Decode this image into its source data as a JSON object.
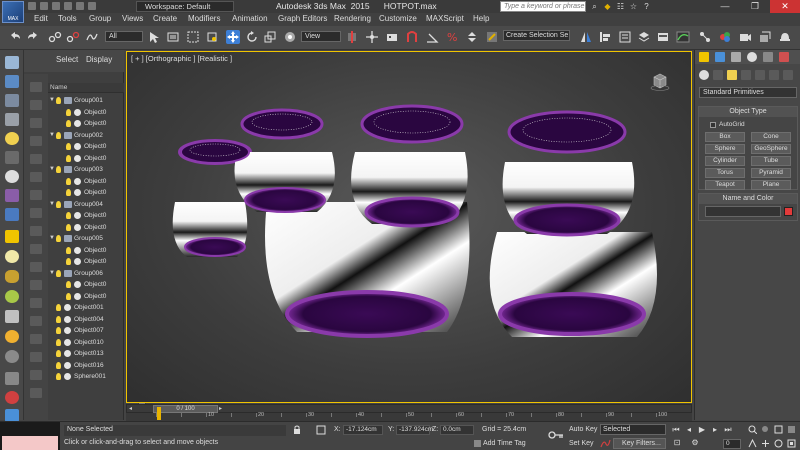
{
  "titlebar": {
    "logo_text": "MAX",
    "workspace_label": "Workspace: Default",
    "app_title": "Autodesk 3ds Max  2015      HOTPOT.max",
    "search_placeholder": "Type a keyword or phrase"
  },
  "menubar": {
    "items": [
      "Edit",
      "Tools",
      "Group",
      "Views",
      "Create",
      "Modifiers",
      "Animation",
      "Graph Editors",
      "Rendering",
      "Customize",
      "MAXScript",
      "Help"
    ]
  },
  "maintoolbar": {
    "selection_filter": "All",
    "reference_coord": "View",
    "named_selection_set": "Create Selection Se"
  },
  "explorer": {
    "tab_select": "Select",
    "tab_display": "Display",
    "column_name": "Name",
    "rows": [
      {
        "label": "Group001",
        "level": 0,
        "type": "group"
      },
      {
        "label": "Object0",
        "level": 1,
        "type": "object"
      },
      {
        "label": "Object0",
        "level": 1,
        "type": "object"
      },
      {
        "label": "Group002",
        "level": 0,
        "type": "group"
      },
      {
        "label": "Object0",
        "level": 1,
        "type": "object"
      },
      {
        "label": "Object0",
        "level": 1,
        "type": "object"
      },
      {
        "label": "Group003",
        "level": 0,
        "type": "group"
      },
      {
        "label": "Object0",
        "level": 1,
        "type": "object"
      },
      {
        "label": "Object0",
        "level": 1,
        "type": "object"
      },
      {
        "label": "Group004",
        "level": 0,
        "type": "group"
      },
      {
        "label": "Object0",
        "level": 1,
        "type": "object"
      },
      {
        "label": "Object0",
        "level": 1,
        "type": "object"
      },
      {
        "label": "Group005",
        "level": 0,
        "type": "group"
      },
      {
        "label": "Object0",
        "level": 1,
        "type": "object"
      },
      {
        "label": "Object0",
        "level": 1,
        "type": "object"
      },
      {
        "label": "Group006",
        "level": 0,
        "type": "group"
      },
      {
        "label": "Object0",
        "level": 1,
        "type": "object"
      },
      {
        "label": "Object0",
        "level": 1,
        "type": "object"
      },
      {
        "label": "Object001",
        "level": 0,
        "type": "object"
      },
      {
        "label": "Object004",
        "level": 0,
        "type": "object"
      },
      {
        "label": "Object007",
        "level": 0,
        "type": "object"
      },
      {
        "label": "Object010",
        "level": 0,
        "type": "object"
      },
      {
        "label": "Object013",
        "level": 0,
        "type": "object"
      },
      {
        "label": "Object016",
        "level": 0,
        "type": "object"
      },
      {
        "label": "Sphere001",
        "level": 0,
        "type": "object"
      }
    ]
  },
  "viewport": {
    "label": "[ + ] [Orthographic ] [Realistic ]",
    "accent_color": "#f0c400"
  },
  "cmdpanel": {
    "primitive_category": "Standard Primitives",
    "object_type_title": "Object Type",
    "autogrid_label": "AutoGrid",
    "primitives": [
      "Box",
      "Cone",
      "Sphere",
      "GeoSphere",
      "Cylinder",
      "Tube",
      "Torus",
      "Pyramid",
      "Teapot",
      "Plane"
    ],
    "name_color_title": "Name and Color",
    "object_color": "#e23a3a"
  },
  "timeline": {
    "slider_text": "0 / 100",
    "ticks": [
      0,
      10,
      20,
      30,
      40,
      50,
      60,
      70,
      80,
      90,
      100
    ]
  },
  "statusbar": {
    "selection_status": "None Selected",
    "prompt": "Click or click-and-drag to select and move objects",
    "x_label": "X:",
    "x_value": "-17.124cm",
    "y_label": "Y:",
    "y_value": "-137.924cm",
    "z_label": "Z:",
    "z_value": "0.0cm",
    "grid": "Grid = 25.4cm",
    "add_time_tag": "Add Time Tag",
    "auto_key": "Auto Key",
    "set_key": "Set Key",
    "key_mode": "Selected",
    "key_filters": "Key Filters...",
    "current_frame": "0"
  }
}
